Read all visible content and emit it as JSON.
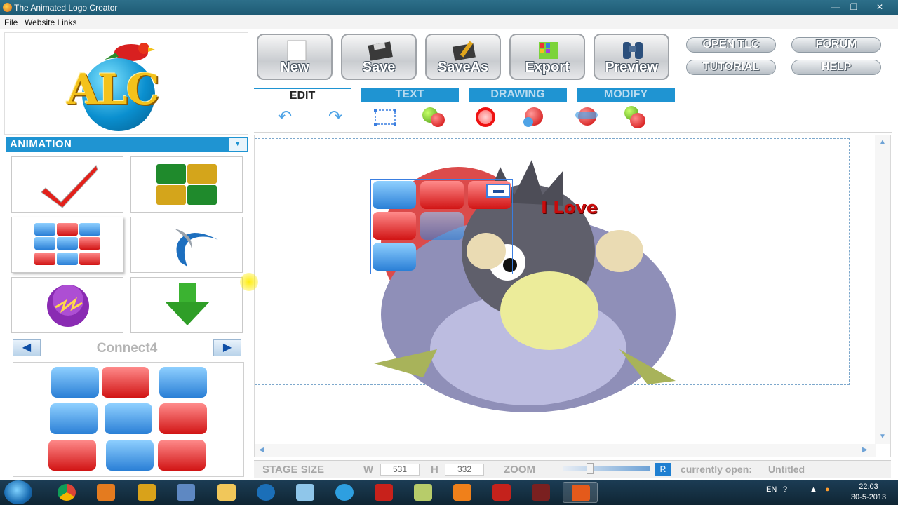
{
  "window": {
    "title": "The Animated Logo Creator",
    "minimize": "—",
    "maximize": "❐",
    "close": "✕"
  },
  "menu": {
    "file": "File",
    "website_links": "Website Links"
  },
  "logo": {
    "text": "ALC"
  },
  "animation_panel": {
    "header": "ANIMATION",
    "dropdown": "▼",
    "current_name": "Connect4",
    "prev": "◀",
    "next": "▶"
  },
  "toolbar": {
    "new": "New",
    "save": "Save",
    "saveas": "SaveAs",
    "export": "Export",
    "preview": "Preview",
    "open_tlc": "OPEN TLC",
    "forum": "FORUM",
    "tutorial": "TUTORIAL",
    "help": "HELP"
  },
  "tabs": {
    "edit": "EDIT",
    "text": "TEXT",
    "drawing": "DRAWING",
    "modify": "MODIFY"
  },
  "edit_tools": {
    "undo": "↶",
    "redo": "↷"
  },
  "stage": {
    "logo_text": "I Love"
  },
  "status": {
    "stage_size_label": "STAGE SIZE",
    "w_label": "W",
    "w_value": "531",
    "h_label": "H",
    "h_value": "332",
    "zoom_label": "ZOOM",
    "r_button": "R",
    "currently_open_label": "currently open:",
    "currently_open_value": "Untitled"
  },
  "taskbar": {
    "language": "EN",
    "time": "22:03",
    "date": "30-5-2013"
  },
  "colors": {
    "accent_blue": "#1f94d2",
    "tile_red": "#d11414",
    "tile_blue": "#2a7fd6",
    "taskbar": "#1c3d55"
  },
  "icons": [
    "app-icon",
    "undo-icon",
    "redo-icon",
    "selection-icon",
    "remove-ball-icon",
    "no-entry-icon",
    "refresh-ball-icon",
    "swap-ball-icon",
    "red-ball-icon",
    "checkmark-icon",
    "grid-icon",
    "swirl-icon",
    "orb-icon",
    "down-arrow-icon",
    "cursor-highlight"
  ]
}
